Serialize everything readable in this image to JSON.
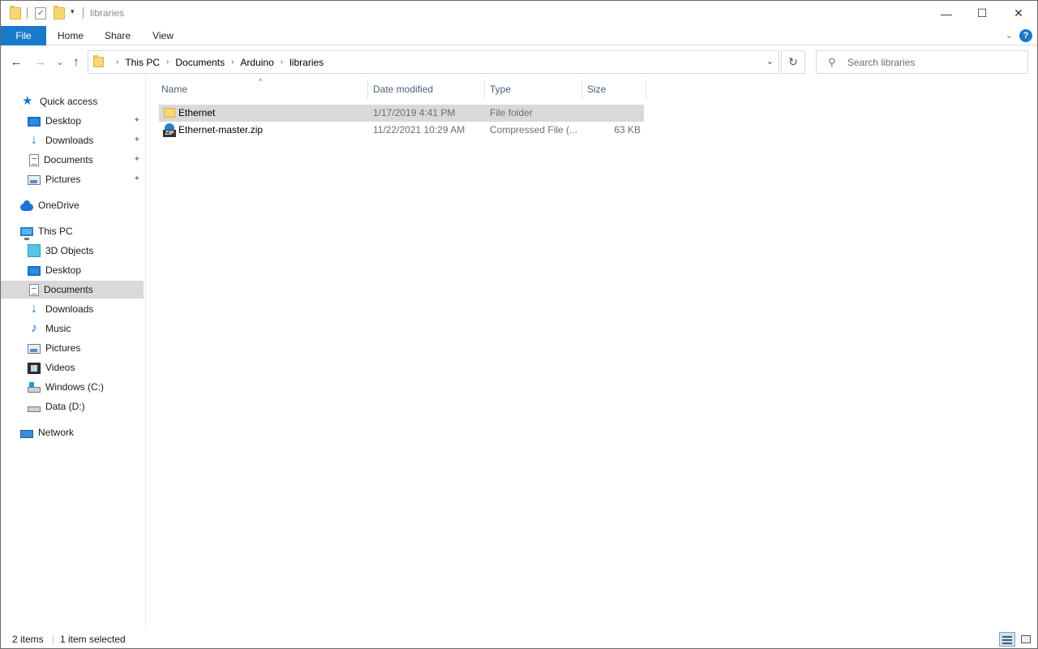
{
  "window": {
    "title": "libraries",
    "minimize_glyph": "—",
    "maximize_glyph": "☐",
    "close_glyph": "✕"
  },
  "ribbon": {
    "tabs": [
      {
        "label": "File"
      },
      {
        "label": "Home"
      },
      {
        "label": "Share"
      },
      {
        "label": "View"
      }
    ],
    "help_glyph": "?",
    "collapse_glyph": "⌄"
  },
  "navigation": {
    "back_glyph": "←",
    "forward_glyph": "→",
    "recent_glyph": "⌄",
    "up_glyph": "↑",
    "breadcrumbs": [
      "This PC",
      "Documents",
      "Arduino",
      "libraries"
    ],
    "separator": "›",
    "dropdown_glyph": "⌄",
    "refresh_glyph": "↻",
    "search": {
      "placeholder": "Search libraries",
      "icon_glyph": "⚲"
    }
  },
  "sidebar": {
    "quick_access": {
      "label": "Quick access",
      "items": [
        {
          "label": "Desktop",
          "icon": "desktop-icon",
          "pinned": true
        },
        {
          "label": "Downloads",
          "icon": "downloads-icon",
          "pinned": true
        },
        {
          "label": "Documents",
          "icon": "documents-icon",
          "pinned": true
        },
        {
          "label": "Pictures",
          "icon": "pictures-icon",
          "pinned": true
        }
      ]
    },
    "onedrive": {
      "label": "OneDrive"
    },
    "this_pc": {
      "label": "This PC",
      "items": [
        {
          "label": "3D Objects",
          "icon": "3d-objects-icon"
        },
        {
          "label": "Desktop",
          "icon": "desktop-icon"
        },
        {
          "label": "Documents",
          "icon": "documents-icon",
          "selected": true
        },
        {
          "label": "Downloads",
          "icon": "downloads-icon"
        },
        {
          "label": "Music",
          "icon": "music-icon"
        },
        {
          "label": "Pictures",
          "icon": "pictures-icon"
        },
        {
          "label": "Videos",
          "icon": "videos-icon"
        },
        {
          "label": "Windows (C:)",
          "icon": "windows-drive-icon"
        },
        {
          "label": "Data (D:)",
          "icon": "data-drive-icon"
        }
      ]
    },
    "network": {
      "label": "Network"
    },
    "pin_glyph": "📌"
  },
  "file_list": {
    "columns": {
      "name": "Name",
      "date_modified": "Date modified",
      "type": "Type",
      "size": "Size"
    },
    "sort_glyph": "^",
    "rows": [
      {
        "name": "Ethernet",
        "date_modified": "1/17/2019 4:41 PM",
        "type": "File folder",
        "size": "",
        "icon": "folder-icon",
        "selected": true
      },
      {
        "name": "Ethernet-master.zip",
        "date_modified": "11/22/2021 10:29 AM",
        "type": "Compressed File (...",
        "size": "63 KB",
        "icon": "zip-file-icon",
        "selected": false
      }
    ],
    "zip_label": "ZIP"
  },
  "status": {
    "item_count": "2 items",
    "selection": "1 item selected"
  },
  "colors": {
    "accent": "#1979ca",
    "selection": "#d9d9d9"
  }
}
